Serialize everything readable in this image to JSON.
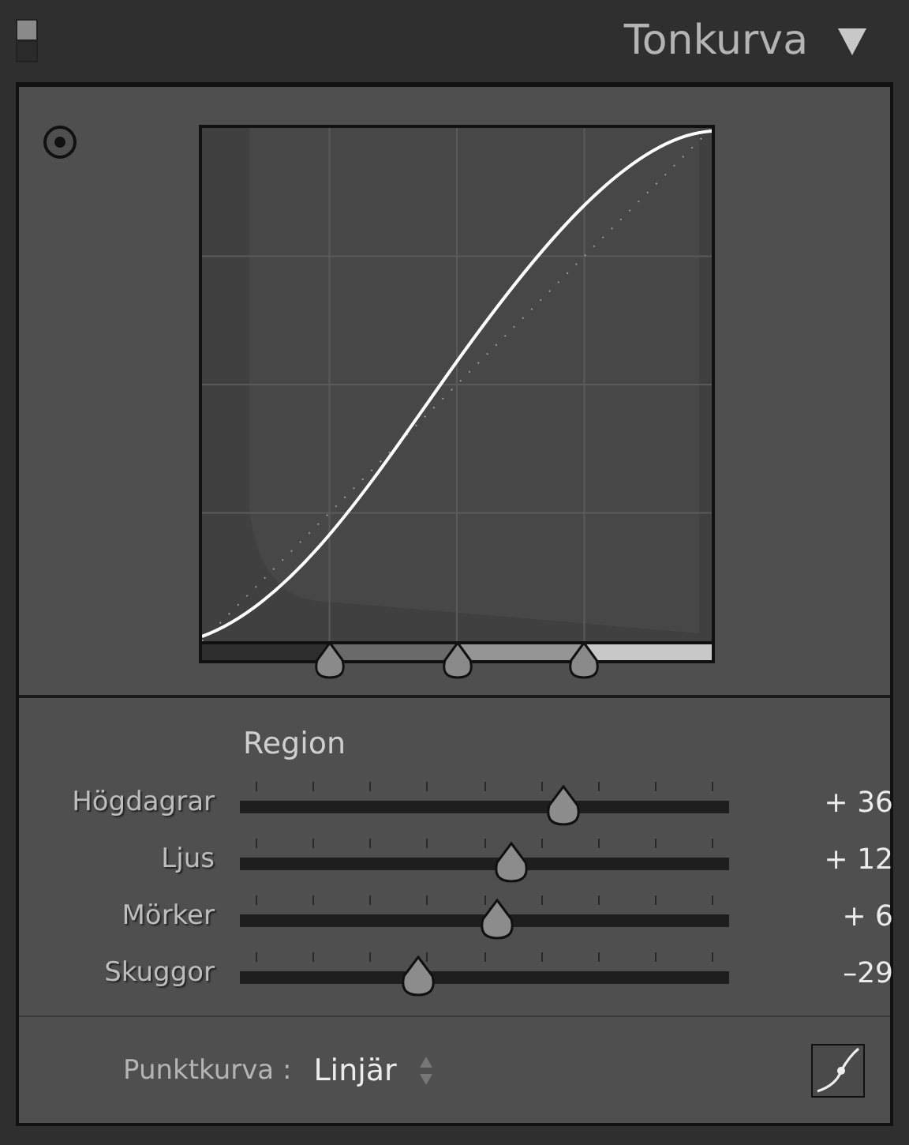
{
  "panel": {
    "title": "Tonkurva",
    "on": true,
    "expanded": true
  },
  "curve": {
    "splits": [
      {
        "level": 0.25
      },
      {
        "level": 0.5
      },
      {
        "level": 0.75
      }
    ]
  },
  "region": {
    "heading": "Region",
    "sliders": [
      {
        "label": "Högdagrar",
        "level": 0.66,
        "reading": "+ 36"
      },
      {
        "label": "Ljus",
        "level": 0.555,
        "reading": "+ 12"
      },
      {
        "label": "Mörker",
        "level": 0.527,
        "reading": "+ 6"
      },
      {
        "label": "Skuggor",
        "level": 0.365,
        "reading": "–29"
      }
    ]
  },
  "point_curve": {
    "label": "Punktkurva :",
    "value": "Linjär"
  }
}
